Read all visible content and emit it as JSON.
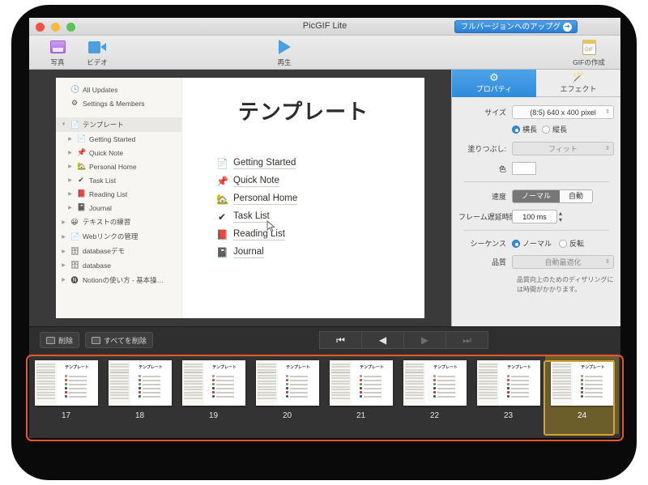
{
  "window": {
    "title": "PicGIF Lite",
    "upgrade_label": "フルバージョンへのアップグ",
    "upgrade_arrow": "➔"
  },
  "toolbar": {
    "items": [
      {
        "label": "写真",
        "icon": "photo-icon"
      },
      {
        "label": "ビデオ",
        "icon": "video-icon"
      },
      {
        "label": "再生",
        "icon": "play-icon"
      },
      {
        "label": "GIFの作成",
        "icon": "gif-icon"
      }
    ],
    "gif_badge": "GIF"
  },
  "preview": {
    "sidebar": [
      {
        "label": "All Updates",
        "emoji": "🕓",
        "indent": 0,
        "arrow": "",
        "selected": false
      },
      {
        "label": "Settings & Members",
        "emoji": "⚙",
        "indent": 0,
        "arrow": "",
        "selected": false
      },
      {
        "label": "テンプレート",
        "emoji": "📄",
        "indent": 0,
        "arrow": "▼",
        "selected": true
      },
      {
        "label": "Getting Started",
        "emoji": "📄",
        "indent": 1,
        "arrow": "▶",
        "selected": false
      },
      {
        "label": "Quick Note",
        "emoji": "📌",
        "indent": 1,
        "arrow": "▶",
        "selected": false
      },
      {
        "label": "Personal Home",
        "emoji": "🏡",
        "indent": 1,
        "arrow": "▶",
        "selected": false
      },
      {
        "label": "Task List",
        "emoji": "✔",
        "indent": 1,
        "arrow": "▶",
        "selected": false
      },
      {
        "label": "Reading List",
        "emoji": "📕",
        "indent": 1,
        "arrow": "▶",
        "selected": false
      },
      {
        "label": "Journal",
        "emoji": "📓",
        "indent": 1,
        "arrow": "▶",
        "selected": false
      },
      {
        "label": "テキストの練習",
        "emoji": "😀",
        "indent": 0,
        "arrow": "▶",
        "selected": false
      },
      {
        "label": "Webリンクの管理",
        "emoji": "📄",
        "indent": 0,
        "arrow": "▶",
        "selected": false
      },
      {
        "label": "databaseデモ",
        "emoji": "🗄",
        "indent": 0,
        "arrow": "▶",
        "selected": false
      },
      {
        "label": "database",
        "emoji": "🗄",
        "indent": 0,
        "arrow": "▶",
        "selected": false
      },
      {
        "label": "Notionの使い方 - 基本操…",
        "emoji": "🅝",
        "indent": 0,
        "arrow": "▶",
        "selected": false
      }
    ],
    "doc_title": "テンプレート",
    "doc_list": [
      {
        "label": "Getting Started",
        "emoji": "📄"
      },
      {
        "label": "Quick Note",
        "emoji": "📌"
      },
      {
        "label": "Personal Home",
        "emoji": "🏡"
      },
      {
        "label": "Task List",
        "emoji": "✔"
      },
      {
        "label": "Reading List",
        "emoji": "📕"
      },
      {
        "label": "Journal",
        "emoji": "📓"
      }
    ]
  },
  "properties": {
    "tabs": [
      {
        "label": "プロパティ",
        "icon": "gear-icon",
        "glyph": "⚙",
        "active": true
      },
      {
        "label": "エフェクト",
        "icon": "magic-wand-icon",
        "glyph": "🪄",
        "active": false
      }
    ],
    "size_label": "サイズ",
    "size_value": "(8:5) 640 x 400 pixel",
    "orientation": [
      {
        "label": "横長",
        "selected": true
      },
      {
        "label": "縦長",
        "selected": false
      }
    ],
    "fill_label": "塗りつぶし:",
    "fill_value": "フィット",
    "color_label": "色",
    "color_value": "#ffffff",
    "speed_label": "速度",
    "speed_options": [
      {
        "label": "ノーマル",
        "selected": true
      },
      {
        "label": "自動",
        "selected": false
      }
    ],
    "delay_label": "フレーム遅延時間",
    "delay_value": "100 ms",
    "sequence_label": "シーケンス",
    "sequence_options": [
      {
        "label": "ノーマル",
        "selected": true
      },
      {
        "label": "反転",
        "selected": false
      }
    ],
    "quality_label": "品質",
    "quality_value": "自動最適化",
    "quality_hint": "品質向上のためのディザリングには時間がかかります。"
  },
  "controls": {
    "delete_label": "削除",
    "delete_all_label": "すべてを削除",
    "nav": [
      {
        "name": "first-frame",
        "glyph": "⏮",
        "dim": false
      },
      {
        "name": "prev-frame",
        "glyph": "◀",
        "dim": false
      },
      {
        "name": "next-frame",
        "glyph": "▶",
        "dim": true
      },
      {
        "name": "last-frame",
        "glyph": "⏭",
        "dim": true
      }
    ]
  },
  "filmstrip": {
    "frames": [
      {
        "number": "17",
        "selected": false
      },
      {
        "number": "18",
        "selected": false
      },
      {
        "number": "19",
        "selected": false
      },
      {
        "number": "20",
        "selected": false
      },
      {
        "number": "21",
        "selected": false
      },
      {
        "number": "22",
        "selected": false
      },
      {
        "number": "23",
        "selected": false
      },
      {
        "number": "24",
        "selected": true
      }
    ],
    "thumb_title": "テンプレート"
  },
  "annotation": {
    "strip_border_color": "#e8572c",
    "selected_border_color": "#d0a535"
  }
}
